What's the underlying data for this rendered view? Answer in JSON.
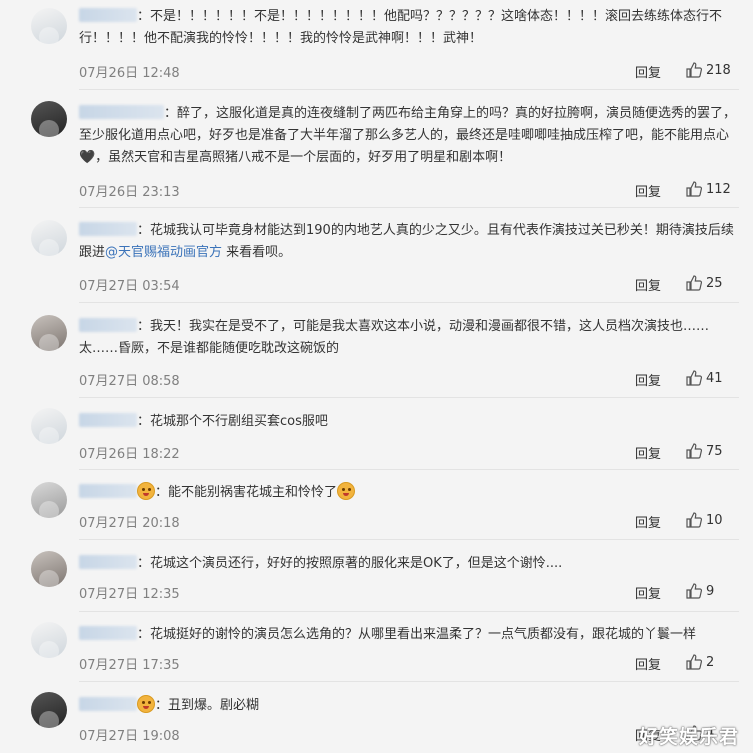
{
  "comments": [
    {
      "text": "不是！！！！！！不是！！！！！！！！他配吗？？？？？？这啥体态！！！！滚回去练练体态行不行！！！！他不配演我的怜怜！！！！我的怜怜是武神啊！！！武神！",
      "time": "07月26日 12:48",
      "reply": "回复",
      "likes": "218"
    },
    {
      "text": "醉了，这服化道是真的连夜缝制了两匹布给主角穿上的吗？真的好拉胯啊，演员随便选秀的罢了，至少服化道用点心吧，好歹也是准备了大半年溜了那么多艺人的，最终还是哇唧唧哇抽成压榨了吧，能不能用点心🖤，虽然天官和吉星高照猪八戒不是一个层面的，好歹用了明星和剧本啊！",
      "time": "07月26日 23:13",
      "reply": "回复",
      "likes": "112"
    },
    {
      "text_before": "花城我认可毕竟身材能达到190的内地艺人真的少之又少。且有代表作演技过关已秒关！期待演技后续跟进",
      "mention": "@天官赐福动画官方",
      "text_after": " 来看看呗。",
      "time": "07月27日 03:54",
      "reply": "回复",
      "likes": "25"
    },
    {
      "text": "我天！我实在是受不了，可能是我太喜欢这本小说，动漫和漫画都很不错，这人员档次演技也……太……昏厥，不是谁都能随便吃耽改这碗饭的",
      "time": "07月27日 08:58",
      "reply": "回复",
      "likes": "41"
    },
    {
      "text": "花城那个不行剧组买套cos服吧",
      "time": "07月26日 18:22",
      "reply": "回复",
      "likes": "75"
    },
    {
      "text": "能不能别祸害花城主和怜怜了",
      "time": "07月27日 20:18",
      "reply": "回复",
      "likes": "10"
    },
    {
      "text": "花城这个演员还行，好好的按照原著的服化来是OK了，但是这个谢怜....",
      "time": "07月27日 12:35",
      "reply": "回复",
      "likes": "9"
    },
    {
      "text": "花城挺好的谢怜的演员怎么选角的？从哪里看出来温柔了？一点气质都没有，跟花城的丫鬟一样",
      "time": "07月27日 17:35",
      "reply": "回复",
      "likes": "2"
    },
    {
      "text": "丑到爆。剧必糊",
      "time": "07月27日 19:08",
      "reply": "回复",
      "likes": "4"
    }
  ],
  "watermark": "好笑娱乐君"
}
